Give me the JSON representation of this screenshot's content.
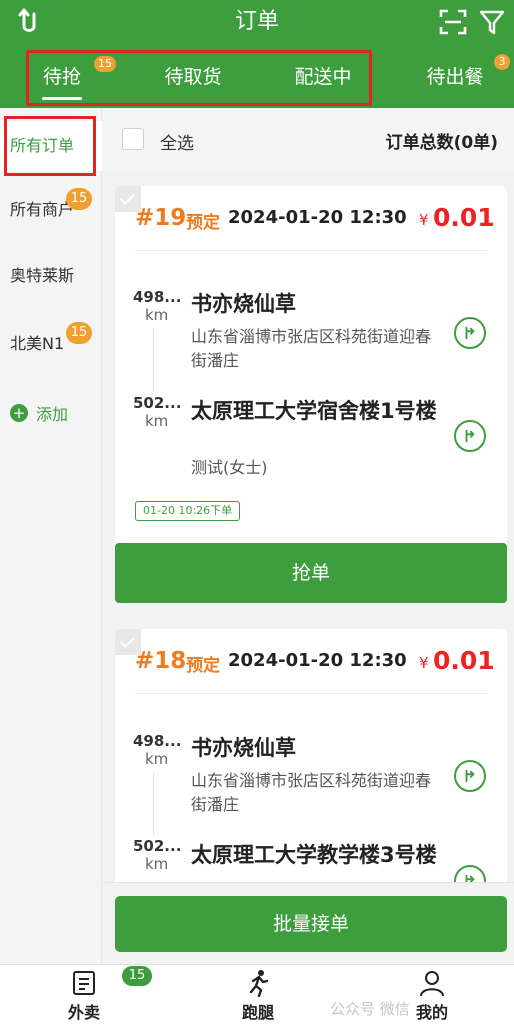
{
  "header": {
    "title": "订单"
  },
  "tabs": [
    {
      "label": "待抢",
      "badge": "15",
      "active": true
    },
    {
      "label": "待取货"
    },
    {
      "label": "配送中"
    },
    {
      "label": "待出餐",
      "badge": "3"
    }
  ],
  "sidebar": {
    "items": [
      {
        "label": "所有订单",
        "active": true
      },
      {
        "label": "所有商户",
        "badge": "15"
      },
      {
        "label": "奥特莱斯"
      },
      {
        "label": "北美N1",
        "badge": "15"
      }
    ],
    "add_label": "添加"
  },
  "topbar": {
    "select_all": "全选",
    "order_count": "订单总数(0单)"
  },
  "orders": [
    {
      "number": "#19",
      "tag": "预定",
      "time": "2024-01-20 12:30",
      "currency": "¥",
      "price": "0.01",
      "pickup": {
        "distance": "498...",
        "unit": "km",
        "name": "书亦烧仙草",
        "address": "山东省淄博市张店区科苑街道迎春街潘庄"
      },
      "dropoff": {
        "distance": "502...",
        "unit": "km",
        "name": "太原理工大学宿舍楼1号楼",
        "contact": "测试(女士)"
      },
      "placed": "01-20 10:26下单",
      "action": "抢单"
    },
    {
      "number": "#18",
      "tag": "预定",
      "time": "2024-01-20 12:30",
      "currency": "¥",
      "price": "0.01",
      "pickup": {
        "distance": "498...",
        "unit": "km",
        "name": "书亦烧仙草",
        "address": "山东省淄博市张店区科苑街道迎春街潘庄"
      },
      "dropoff": {
        "distance": "502...",
        "unit": "km",
        "name": "太原理工大学教学楼3号楼"
      }
    }
  ],
  "batch_button": "批量接单",
  "bottom_nav": {
    "items": [
      {
        "label": "外卖",
        "icon": "document-list-icon"
      },
      {
        "label": "跑腿",
        "icon": "runner-icon"
      },
      {
        "label": "我的",
        "icon": "user-icon"
      }
    ],
    "badge": "15"
  },
  "watermark": "公众号 微信"
}
